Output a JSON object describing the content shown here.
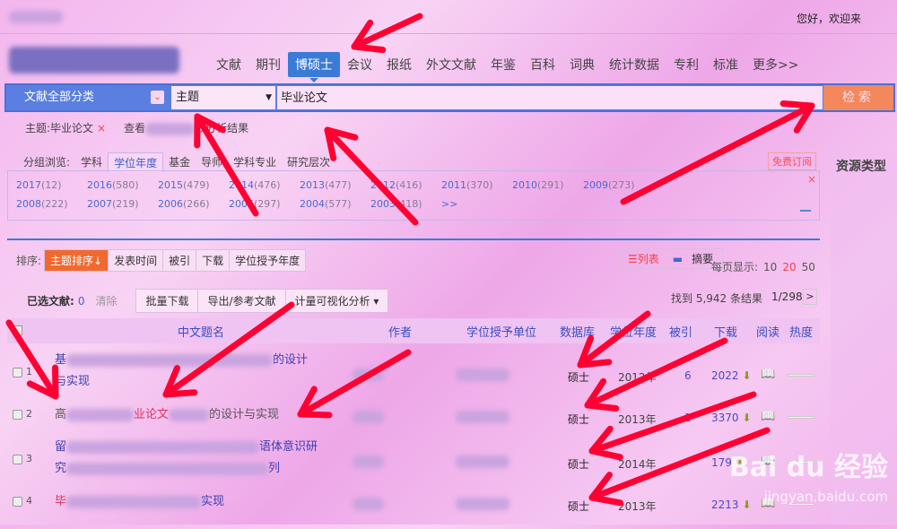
{
  "header": {
    "greeting": "您好，欢迎来"
  },
  "nav": {
    "items": [
      "文献",
      "期刊",
      "博硕士",
      "会议",
      "报纸",
      "外文文献",
      "年鉴",
      "百科",
      "词典",
      "统计数据",
      "专利",
      "标准",
      "更多>>"
    ],
    "active": 2
  },
  "search": {
    "category": "文献全部分类",
    "field": "主题",
    "query": "毕业论文",
    "button": "检索"
  },
  "crumb": {
    "tag": "主题:毕业论文",
    "close": "×",
    "view_prefix": "查看",
    "view_suffix": "数分析结果"
  },
  "group": {
    "label": "分组浏览:",
    "tabs": [
      "学科",
      "学位年度",
      "基金",
      "导师",
      "学科专业",
      "研究层次"
    ],
    "active": 1,
    "subscribe": "免费订阅",
    "close": "×",
    "years": [
      [
        "2017",
        "(12)"
      ],
      [
        "2016",
        "(580)"
      ],
      [
        "2015",
        "(479)"
      ],
      [
        "2014",
        "(476)"
      ],
      [
        "2013",
        "(477)"
      ],
      [
        "2012",
        "(416)"
      ],
      [
        "2011",
        "(370)"
      ],
      [
        "2010",
        "(291)"
      ],
      [
        "2009",
        "(273)"
      ],
      [
        "2008",
        "(222)"
      ],
      [
        "2007",
        "(219)"
      ],
      [
        "2006",
        "(266)"
      ],
      [
        "2005",
        "(297)"
      ],
      [
        "2004",
        "(577)"
      ],
      [
        "2003",
        "(418)"
      ]
    ],
    "more": ">>"
  },
  "sort": {
    "label": "排序:",
    "options": [
      "主题排序↓",
      "发表时间",
      "被引",
      "下载",
      "学位授予年度"
    ]
  },
  "view": {
    "list": "☰列表",
    "abstract": "摘要"
  },
  "perpage": {
    "label": "每页显示:",
    "options": [
      "10",
      "20",
      "50"
    ],
    "active": "20"
  },
  "selection": {
    "label": "已选文献:",
    "count": "0",
    "clear": "清除",
    "buttons": [
      "批量下载",
      "导出/参考文献",
      "计量可视化分析 ▾"
    ]
  },
  "results": {
    "found": "找到 5,942 条结果",
    "page": "1/298",
    "next": ">"
  },
  "table": {
    "headers": [
      "中文题名",
      "作者",
      "学位授予单位",
      "数据库",
      "学位年度",
      "被引",
      "下载",
      "阅读",
      "热度"
    ],
    "rows": [
      {
        "n": "1",
        "t1": "基",
        "t2": "的设计",
        "t3": "与实现",
        "db": "硕士",
        "yr": "2012年",
        "ci": "6",
        "dl": "2022"
      },
      {
        "n": "2",
        "t1": "高",
        "t2": "业论文",
        "t3": "的设计与实现",
        "db": "硕士",
        "yr": "2013年",
        "ci": "1",
        "dl": "3370"
      },
      {
        "n": "3",
        "t1": "留",
        "t2": "语体意识研",
        "t3": "究",
        "t4": "列",
        "db": "硕士",
        "yr": "2014年",
        "ci": "",
        "dl": "179"
      },
      {
        "n": "4",
        "t1": "毕",
        "t2": "实现",
        "db": "硕士",
        "yr": "2013年",
        "ci": "",
        "dl": "2213"
      }
    ]
  },
  "sidebar": {
    "title": "资源类型"
  },
  "watermark": {
    "brand": "Bai du 经验",
    "url": "jingyan.baidu.com"
  },
  "colors": {
    "accent": "#3a7bd5",
    "search_button": "#f2885c",
    "sort_active": "#f06a30",
    "arrow": "#ff0033"
  }
}
